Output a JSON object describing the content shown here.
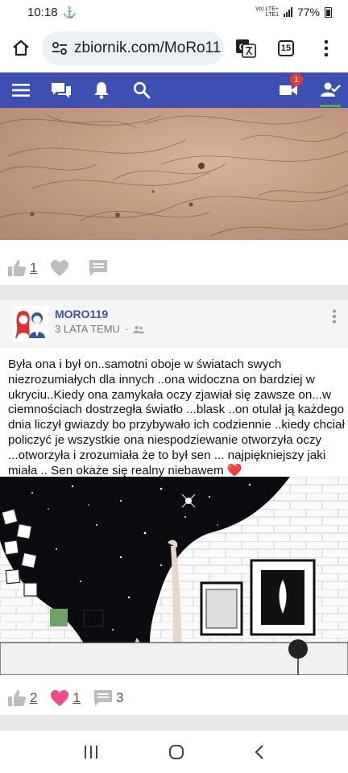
{
  "status_bar": {
    "time": "10:18",
    "network_top": "Vo) LTE+",
    "network_bottom": "LTE1",
    "battery": "77%"
  },
  "browser": {
    "url": "zbiornik.com/MoRo11",
    "tab_count": "15"
  },
  "site_nav": {
    "video_badge": "1",
    "icons": [
      "menu-icon",
      "chat-icon",
      "bell-icon",
      "search-icon",
      "video-icon",
      "friends-icon"
    ],
    "accent_color": "#3e4fb3",
    "active_color": "#4caf50"
  },
  "first_post": {
    "likes": "1"
  },
  "post": {
    "author": "MORO119",
    "time_ago": "3 LATA TEMU",
    "separator": "·",
    "text": "Była ona i był on..samotni oboje w światach swych niezrozumiałych dla innych ..ona widoczna on bardziej w ukryciu..Kiedy ona zamykała oczy zjawiał się zawsze on...w ciemnościach dostrzegła światło ...blask ..on otulał ją każdego dnia liczył gwiazdy bo przybywało ich codziennie ..kiedy chciał policzyć je wszystkie ona niespodziewanie otworzyła oczy ...otworzyła i zrozumiała że to był sen ... najpiękniejszy jaki miała .. Sen okaże się realny niebawem ❤️",
    "likes": "2",
    "hearts": "1",
    "comments": "3"
  }
}
